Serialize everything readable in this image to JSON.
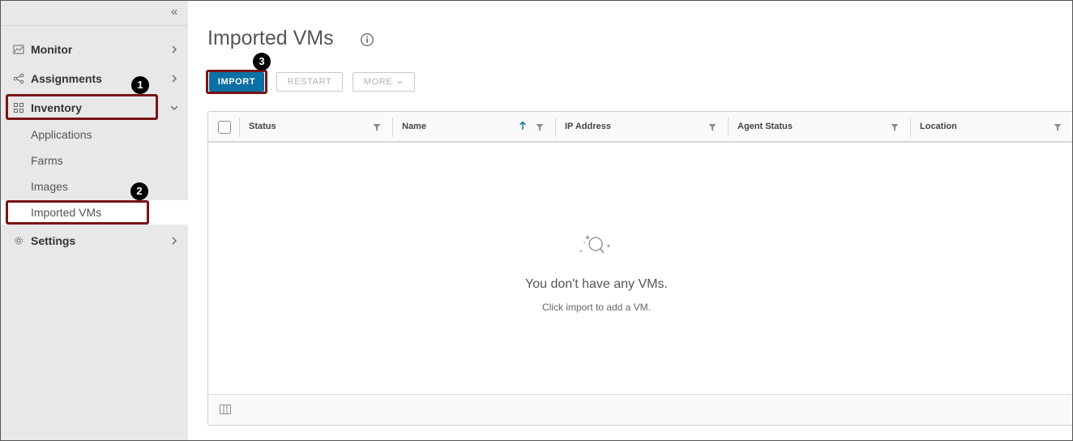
{
  "sidebar": {
    "collapse_glyph": "«",
    "items": [
      {
        "label": "Monitor",
        "icon": "monitor-icon"
      },
      {
        "label": "Assignments",
        "icon": "share-icon"
      },
      {
        "label": "Inventory",
        "icon": "grid-icon",
        "expanded": true,
        "children": [
          {
            "label": "Applications"
          },
          {
            "label": "Farms"
          },
          {
            "label": "Images"
          },
          {
            "label": "Imported VMs",
            "active": true
          }
        ]
      },
      {
        "label": "Settings",
        "icon": "gear-icon"
      }
    ]
  },
  "annotations": {
    "badge1": "1",
    "badge2": "2",
    "badge3": "3",
    "highlight_color": "#7a1416"
  },
  "main": {
    "title": "Imported VMs",
    "toolbar": {
      "import_label": "IMPORT",
      "restart_label": "RESTART",
      "more_label": "MORE"
    },
    "grid": {
      "columns": [
        {
          "label": "Status"
        },
        {
          "label": "Name",
          "sorted": "ascending"
        },
        {
          "label": "IP Address"
        },
        {
          "label": "Agent Status"
        },
        {
          "label": "Location"
        }
      ],
      "empty_title": "You don't have any VMs.",
      "empty_subtitle": "Click import to add a VM."
    }
  },
  "colors": {
    "primary": "#0b70a3",
    "sidebar_bg": "#e8e8e8",
    "annotation": "#7a1416"
  }
}
